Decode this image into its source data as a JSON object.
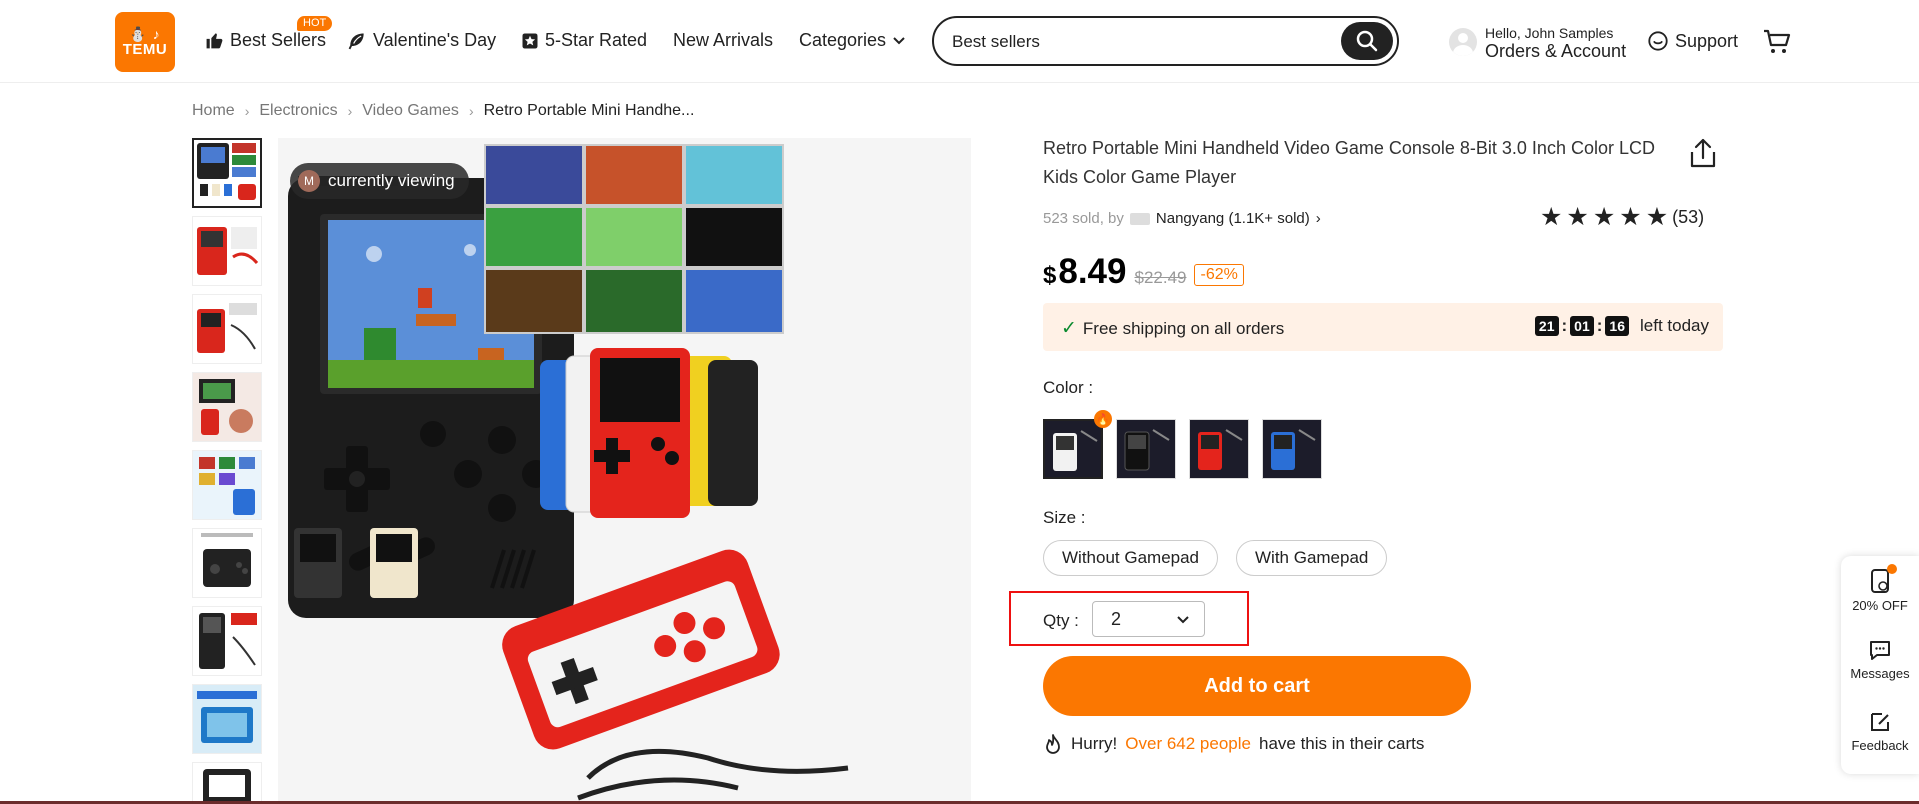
{
  "header": {
    "logo_text": "TEMU",
    "nav": {
      "best_sellers": "Best Sellers",
      "hot_badge": "HOT",
      "valentines": "Valentine's Day",
      "five_star": "5-Star Rated",
      "new_arrivals": "New Arrivals",
      "categories": "Categories"
    },
    "search_value": "Best sellers",
    "account_hello": "Hello, John Samples",
    "account_orders": "Orders & Account",
    "support": "Support"
  },
  "breadcrumb": [
    "Home",
    "Electronics",
    "Video Games",
    "Retro Portable Mini Handhe..."
  ],
  "viewer": {
    "initial": "M",
    "currently_viewing": "currently viewing"
  },
  "product": {
    "title": "Retro Portable Mini Handheld Video Game Console 8-Bit 3.0 Inch Color LCD Kids Color Game Player",
    "sold": "523 sold, by",
    "seller": "Nangyang (1.1K+ sold)",
    "rating_stars": 5,
    "rating_count": "(53)",
    "price_currency": "$",
    "price": "8.49",
    "old_price": "$22.49",
    "discount": "-62%",
    "shipping": "Free shipping on all orders",
    "timer": {
      "h": "21",
      "m": "01",
      "s": "16"
    },
    "left_today": "left today",
    "color_label": "Color :",
    "colors": [
      "white",
      "black",
      "red",
      "blue"
    ],
    "size_label": "Size :",
    "sizes": [
      "Without Gamepad",
      "With Gamepad"
    ],
    "qty_label": "Qty :",
    "qty_value": "2",
    "add_to_cart": "Add to cart",
    "hurry": "Hurry!",
    "hurry_count": "Over 642 people",
    "hurry_tail": "have this in their carts"
  },
  "float_panel": {
    "discount": "20% OFF",
    "messages": "Messages",
    "feedback": "Feedback"
  },
  "colors": {
    "brand_orange": "#fb7701",
    "highlight_red": "#ee1111",
    "shipping_bg": "#fff1e6"
  }
}
